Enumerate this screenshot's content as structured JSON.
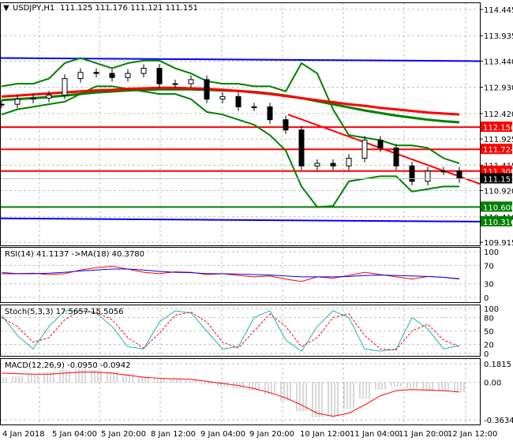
{
  "header": {
    "symbol": "USDJPY,H1",
    "ohlc": "111.125 111.176 111.121 111.151"
  },
  "indicators": {
    "rsi_label": "RSI(14) 41.1137  ->MA(18) 40.3780",
    "stoch_label": "Stoch(5,3,3) 17.5657 15.5056",
    "macd_label": "MACD(12,26,9) -0.0950 -0.0942"
  },
  "colors": {
    "bullish_candle": "#000000",
    "bollinger": "#008000",
    "ma_red": "#ff0000",
    "ma_green": "#008000",
    "support_resistance": "#ff0000",
    "channel": "#0000ff",
    "rsi": "#ff0000",
    "rsi_ma": "#0000ff",
    "stoch_main": "#20b2aa",
    "stoch_signal": "#ff0000",
    "macd_hist": "#b0b0b0",
    "macd_signal": "#ff0000"
  },
  "chart_data": [
    {
      "type": "candlestick",
      "title": "USDJPY,H1",
      "ylim": [
        109.915,
        114.445
      ],
      "y_ticks": [
        "114.445",
        "113.935",
        "113.440",
        "112.930",
        "112.420",
        "111.925",
        "111.415",
        "110.920",
        "110.410",
        "109.915"
      ],
      "x_ticks": [
        "4 Jan 2018",
        "5 Jan 04:00",
        "5 Jan 20:00",
        "8 Jan 12:00",
        "9 Jan 04:00",
        "9 Jan 20:00",
        "10 Jan 12:00",
        "11 Jan 04:00",
        "11 Jan 20:00",
        "12 Jan 12:00"
      ],
      "close": [
        112.6,
        112.7,
        112.72,
        112.78,
        113.1,
        113.22,
        113.2,
        113.12,
        113.2,
        113.3,
        113.0,
        113.0,
        113.08,
        112.7,
        112.75,
        112.55,
        112.55,
        112.3,
        112.1,
        111.4,
        111.45,
        111.4,
        111.55,
        111.9,
        111.75,
        111.4,
        111.1,
        111.3,
        111.3,
        111.151
      ],
      "bollinger_upper": [
        112.95,
        113.0,
        113.0,
        113.1,
        113.4,
        113.5,
        113.4,
        113.3,
        113.4,
        113.45,
        113.45,
        113.3,
        113.2,
        113.05,
        113.0,
        113.0,
        112.95,
        112.95,
        112.85,
        113.4,
        113.2,
        112.5,
        112.0,
        111.95,
        111.9,
        111.8,
        111.8,
        111.75,
        111.55,
        111.45
      ],
      "bollinger_lower": [
        112.4,
        112.5,
        112.55,
        112.6,
        112.65,
        112.8,
        112.95,
        112.95,
        112.9,
        112.85,
        112.8,
        112.8,
        112.7,
        112.45,
        112.4,
        112.3,
        112.2,
        112.0,
        111.7,
        111.0,
        110.6,
        110.62,
        111.1,
        111.15,
        111.2,
        111.2,
        110.9,
        110.95,
        111.0,
        111.0
      ],
      "ma_red": [
        112.75,
        112.77,
        112.79,
        112.81,
        112.83,
        112.85,
        112.87,
        112.88,
        112.9,
        112.91,
        112.92,
        112.92,
        112.91,
        112.9,
        112.88,
        112.86,
        112.83,
        112.8,
        112.76,
        112.72,
        112.68,
        112.64,
        112.6,
        112.57,
        112.53,
        112.5,
        112.47,
        112.44,
        112.42,
        112.4
      ],
      "ma_green": [
        112.68,
        112.7,
        112.72,
        112.74,
        112.77,
        112.8,
        112.83,
        112.85,
        112.87,
        112.88,
        112.89,
        112.89,
        112.89,
        112.88,
        112.87,
        112.86,
        112.84,
        112.81,
        112.77,
        112.72,
        112.66,
        112.6,
        112.54,
        112.48,
        112.43,
        112.38,
        112.34,
        112.3,
        112.27,
        112.25
      ],
      "trendline": [
        112.4,
        111.05
      ],
      "horizontal_levels": [
        {
          "value": 112.156,
          "label": "112.156",
          "color": "#ff0000"
        },
        {
          "value": 111.724,
          "label": "111.724",
          "color": "#ff0000"
        },
        {
          "value": 111.3,
          "label": "111.300",
          "color": "#ff0000"
        },
        {
          "value": 110.6,
          "label": "110.600",
          "color": "#008000"
        }
      ],
      "channel_lines": [
        {
          "from": 113.5,
          "to": 113.44,
          "label": "113.440"
        },
        {
          "from": 110.38,
          "to": 110.316,
          "label": "110.316"
        }
      ],
      "current_price": "111.151"
    },
    {
      "type": "line",
      "title": "RSI(14)",
      "ylim": [
        0,
        100
      ],
      "y_ticks": [
        "100",
        "70",
        "30",
        "0"
      ],
      "series": [
        {
          "name": "RSI(14)",
          "values": [
            55,
            52,
            53,
            50,
            52,
            60,
            65,
            68,
            62,
            55,
            52,
            56,
            55,
            50,
            52,
            48,
            45,
            47,
            40,
            35,
            45,
            42,
            48,
            55,
            50,
            45,
            40,
            46,
            44,
            41.1137
          ]
        },
        {
          "name": "MA(18)",
          "values": [
            52,
            52,
            52,
            53,
            55,
            58,
            60,
            62,
            62,
            60,
            57,
            55,
            54,
            52,
            52,
            51,
            50,
            49,
            47,
            45,
            45,
            45,
            46,
            48,
            49,
            48,
            47,
            46,
            44,
            40.378
          ]
        }
      ]
    },
    {
      "type": "line",
      "title": "Stoch(5,3,3)",
      "ylim": [
        0,
        100
      ],
      "y_ticks": [
        "100",
        "80",
        "50",
        "20",
        "0"
      ],
      "series": [
        {
          "name": "main",
          "values": [
            85,
            40,
            10,
            60,
            95,
            95,
            90,
            60,
            15,
            10,
            70,
            95,
            90,
            50,
            10,
            15,
            80,
            95,
            30,
            5,
            60,
            95,
            80,
            10,
            5,
            10,
            80,
            55,
            10,
            17.5657
          ]
        },
        {
          "name": "signal",
          "values": [
            80,
            60,
            25,
            35,
            75,
            95,
            92,
            75,
            35,
            12,
            45,
            85,
            92,
            70,
            25,
            12,
            50,
            88,
            60,
            15,
            35,
            80,
            88,
            40,
            10,
            8,
            50,
            65,
            30,
            15.5056
          ]
        }
      ]
    },
    {
      "type": "bar",
      "title": "MACD(12,26,9)",
      "ylim": [
        -0.3634,
        0.1815
      ],
      "y_ticks": [
        "0.1815",
        "0.00",
        "-0.3634"
      ],
      "series": [
        {
          "name": "MACD",
          "values": [
            0.05,
            0.06,
            0.08,
            0.1,
            0.12,
            0.13,
            0.12,
            0.1,
            0.08,
            0.06,
            0.04,
            0.03,
            0.02,
            -0.02,
            -0.04,
            -0.06,
            -0.08,
            -0.12,
            -0.18,
            -0.28,
            -0.34,
            -0.33,
            -0.26,
            -0.16,
            -0.07,
            -0.04,
            -0.06,
            -0.08,
            -0.08,
            -0.095
          ]
        },
        {
          "name": "Signal",
          "values": [
            0.09,
            0.085,
            0.08,
            0.08,
            0.09,
            0.1,
            0.1,
            0.09,
            0.07,
            0.05,
            0.04,
            0.035,
            0.03,
            0.01,
            -0.01,
            -0.03,
            -0.06,
            -0.1,
            -0.15,
            -0.22,
            -0.3,
            -0.33,
            -0.3,
            -0.22,
            -0.13,
            -0.08,
            -0.07,
            -0.075,
            -0.08,
            -0.0942
          ]
        }
      ]
    }
  ]
}
